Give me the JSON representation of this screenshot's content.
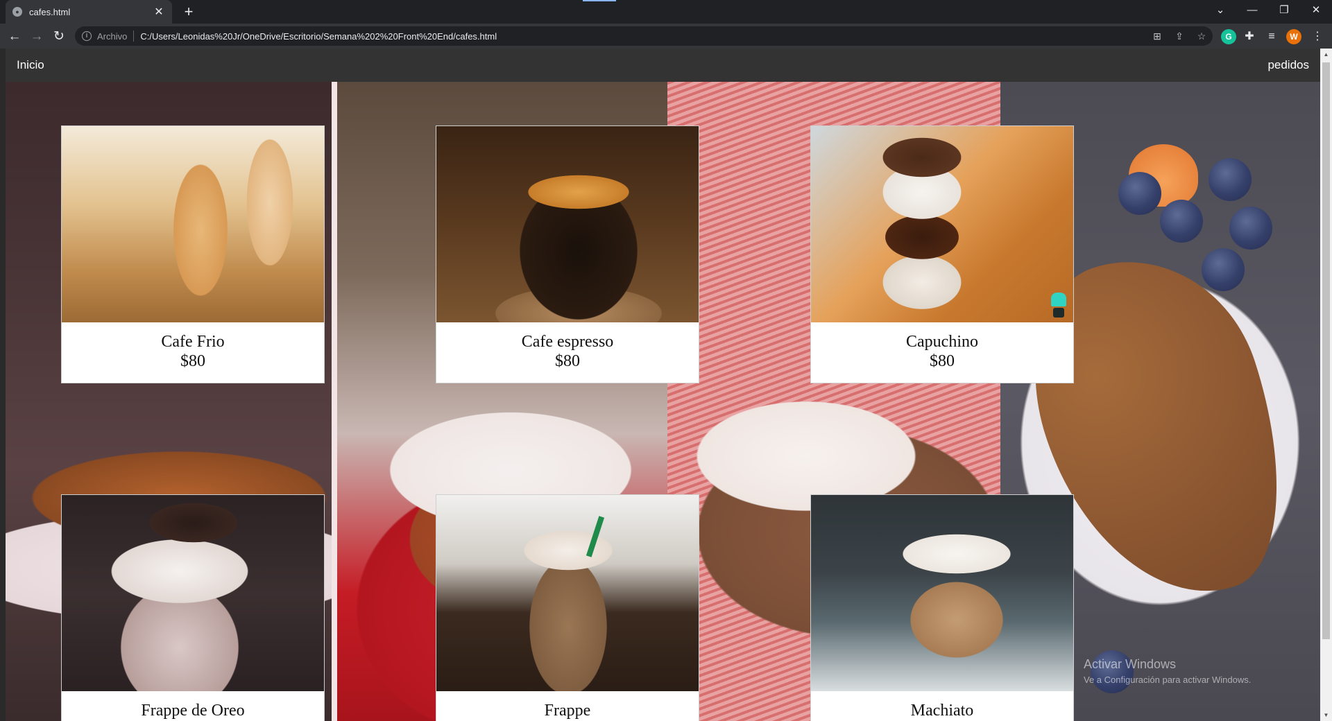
{
  "browser": {
    "tab_title": "cafes.html",
    "tab_close": "✕",
    "new_tab": "+",
    "scheme_label": "Archivo",
    "url": "C:/Users/Leonidas%20Jr/OneDrive/Escritorio/Semana%202%20Front%20End/cafes.html",
    "profile_initial": "W",
    "grammarly_initial": "G"
  },
  "nav": {
    "home_label": "Inicio",
    "orders_label": "pedidos"
  },
  "products": [
    {
      "name": "Cafe Frio",
      "price": "$80"
    },
    {
      "name": "Cafe espresso",
      "price": "$80"
    },
    {
      "name": "Capuchino",
      "price": "$80"
    },
    {
      "name": "Frappe de Oreo",
      "price": ""
    },
    {
      "name": "Frappe",
      "price": ""
    },
    {
      "name": "Machiato",
      "price": ""
    }
  ],
  "watermark": {
    "title": "Activar Windows",
    "subtitle": "Ve a Configuración para activar Windows."
  },
  "colors": {
    "page_nav": "#333333",
    "browser_frame": "#202124",
    "toolbar": "#35363a",
    "profile_avatar": "#e8710a",
    "grammarly": "#15c39a"
  }
}
